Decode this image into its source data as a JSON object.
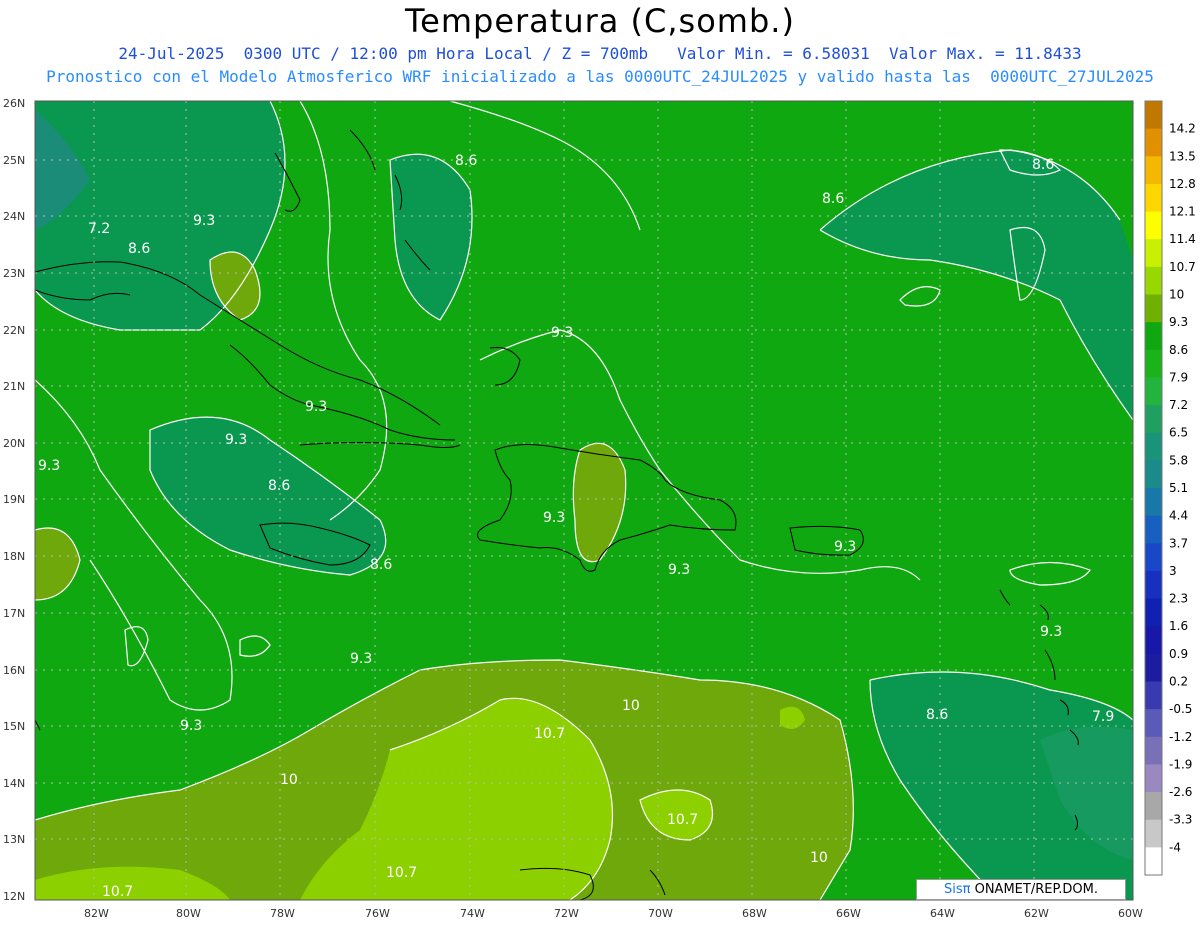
{
  "header": {
    "title": "Temperatura (C,somb.)",
    "subtitle_line1": "24-Jul-2025  0300 UTC / 12:00 pm Hora Local / Z = 700mb   Valor Min. = 6.58031  Valor Max. = 11.8433",
    "subtitle_line2": "Pronostico con el Modelo Atmosferico WRF inicializado a las 0000UTC_24JUL2025 y valido hasta las  0000UTC_27JUL2025"
  },
  "map": {
    "lat_labels": [
      "26N",
      "25N",
      "24N",
      "23N",
      "22N",
      "21N",
      "20N",
      "19N",
      "18N",
      "17N",
      "16N",
      "15N",
      "14N",
      "13N",
      "12N"
    ],
    "lon_labels": [
      "82W",
      "80W",
      "78W",
      "76W",
      "74W",
      "72W",
      "70W",
      "68W",
      "66W",
      "64W",
      "62W",
      "60W"
    ],
    "contour_labels": [
      "8.6",
      "8.6",
      "8.6",
      "7.2",
      "8.6",
      "9.3",
      "9.3",
      "9.3",
      "9.3",
      "9.3",
      "8.6",
      "9.3",
      "8.6",
      "9.3",
      "9.3",
      "9.3",
      "9.3",
      "9.3",
      "10",
      "10.7",
      "10",
      "10.7",
      "10.7",
      "10",
      "10.7",
      "8.6",
      "7.9"
    ]
  },
  "colorbar": {
    "labels": [
      "14.2",
      "13.5",
      "12.8",
      "12.1",
      "11.4",
      "10.7",
      "10",
      "9.3",
      "8.6",
      "7.9",
      "7.2",
      "6.5",
      "5.8",
      "5.1",
      "4.4",
      "3.7",
      "3",
      "2.3",
      "1.6",
      "0.9",
      "0.2",
      "-0.5",
      "-1.2",
      "-1.9",
      "-2.6",
      "-3.3",
      "-4"
    ],
    "colors": [
      "#c07800",
      "#e09000",
      "#f4b800",
      "#ffd700",
      "#ffff00",
      "#c8f000",
      "#98d800",
      "#70b000",
      "#10a810",
      "#1ab41a",
      "#22b43c",
      "#20a060",
      "#1a9478",
      "#1a8a8a",
      "#1878a8",
      "#1860c0",
      "#1848c8",
      "#1830c0",
      "#1020b0",
      "#1818a8",
      "#1c1ca0",
      "#3a3ab0",
      "#5a5ab8",
      "#7a70b8",
      "#9a88c0",
      "#a8a8a8",
      "#c8c8c8",
      "#ffffff"
    ]
  },
  "credit": {
    "brand": "Sisπ",
    "text": " ONAMET/REP.DOM."
  }
}
